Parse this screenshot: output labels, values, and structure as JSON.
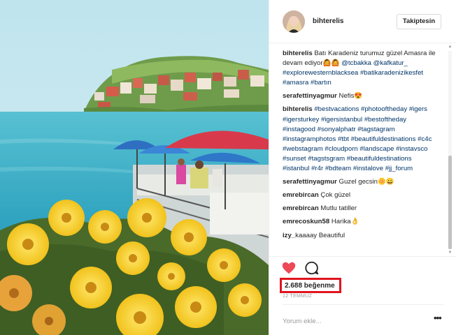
{
  "post": {
    "image_alt": "Amasra harbor with yellow flowers",
    "author": "bihterelis",
    "follow_label": "Takiptesin",
    "likes": "2.688 beğenme",
    "date": "12 TEMMUZ",
    "comment_placeholder": "Yorum ekle...",
    "more_label": "•••"
  },
  "comments": [
    {
      "user": "bihterelis",
      "parts": [
        {
          "text": " Batı Karadeniz turumuz güzel Amasra ile devam ediyor🙆🙆 "
        },
        {
          "tag": "@tcbakka"
        },
        {
          "text": " "
        },
        {
          "tag": "@kafkatur_"
        },
        {
          "text": " "
        },
        {
          "tag": "#explorewesternblacksea"
        },
        {
          "text": " "
        },
        {
          "tag": "#batikaradenizikesfet"
        },
        {
          "text": " "
        },
        {
          "tag": "#amasra"
        },
        {
          "text": " "
        },
        {
          "tag": "#bartın"
        }
      ]
    },
    {
      "user": "serafettinyagmur",
      "parts": [
        {
          "text": " Nefis😍"
        }
      ]
    },
    {
      "user": "bihterelis",
      "parts": [
        {
          "text": " "
        },
        {
          "tag": "#bestvacations"
        },
        {
          "text": " "
        },
        {
          "tag": "#photooftheday"
        },
        {
          "text": " "
        },
        {
          "tag": "#igers"
        },
        {
          "text": " "
        },
        {
          "tag": "#igersturkey"
        },
        {
          "text": " "
        },
        {
          "tag": "#igersistanbul"
        },
        {
          "text": " "
        },
        {
          "tag": "#bestoftheday"
        },
        {
          "text": " "
        },
        {
          "tag": "#instagood"
        },
        {
          "text": " "
        },
        {
          "tag": "#sonyalphatr"
        },
        {
          "text": " "
        },
        {
          "tag": "#tagstagram"
        },
        {
          "text": " "
        },
        {
          "tag": "#instagramphotos"
        },
        {
          "text": " "
        },
        {
          "tag": "#tbt"
        },
        {
          "text": " "
        },
        {
          "tag": "#beautifuldestinations"
        },
        {
          "text": " "
        },
        {
          "tag": "#c4c"
        },
        {
          "text": " "
        },
        {
          "tag": "#webstagram"
        },
        {
          "text": " "
        },
        {
          "tag": "#cloudporn"
        },
        {
          "text": " "
        },
        {
          "tag": "#landscape"
        },
        {
          "text": " "
        },
        {
          "tag": "#instavsco"
        },
        {
          "text": " "
        },
        {
          "tag": "#sunset"
        },
        {
          "text": " "
        },
        {
          "tag": "#tagstsgram"
        },
        {
          "text": " "
        },
        {
          "tag": "#beautifuldestinations"
        },
        {
          "text": " "
        },
        {
          "tag": "#istanbul"
        },
        {
          "text": " "
        },
        {
          "tag": "#r4r"
        },
        {
          "text": " "
        },
        {
          "tag": "#bdteam"
        },
        {
          "text": " "
        },
        {
          "tag": "#instalove"
        },
        {
          "text": " "
        },
        {
          "tag": "#jj_forum"
        }
      ]
    },
    {
      "user": "serafettinyagmur",
      "parts": [
        {
          "text": " Guzel gecsin🌼😀"
        }
      ]
    },
    {
      "user": "emrebircan",
      "parts": [
        {
          "text": " Çok güzel"
        }
      ]
    },
    {
      "user": "emrebircan",
      "parts": [
        {
          "text": " Mutlu tatiller"
        }
      ]
    },
    {
      "user": "emrecoskun58",
      "parts": [
        {
          "text": " Harika👌"
        }
      ]
    },
    {
      "user": "izy_",
      "parts": [
        {
          "text": "kaaaay Beautiful"
        }
      ]
    }
  ],
  "icons": {
    "heart": "heart-icon",
    "comment": "comment-icon",
    "more": "more-icon"
  },
  "colors": {
    "heart": "#ed4956",
    "hashtag": "#003569",
    "highlight": "#e0141e"
  }
}
